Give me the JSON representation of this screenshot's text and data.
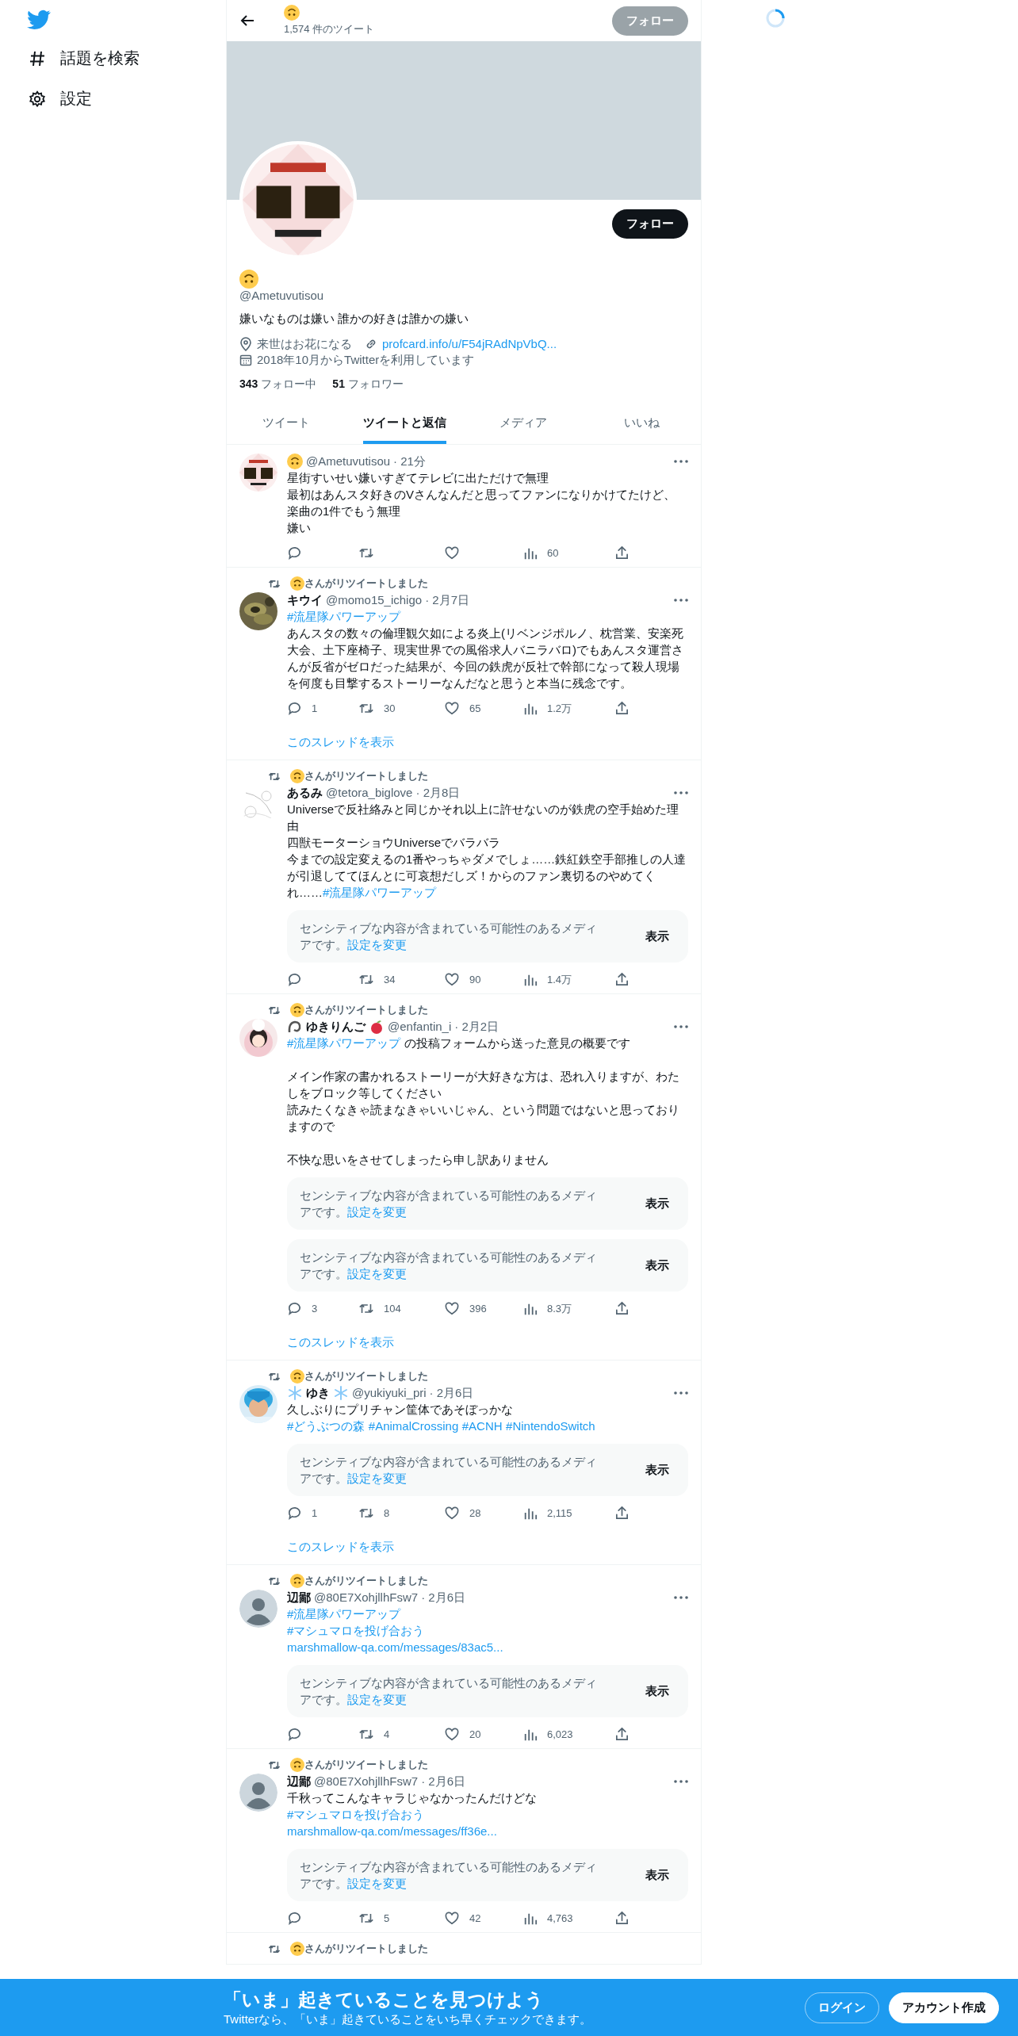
{
  "sidebar": {
    "items": [
      {
        "kind": "hashtag",
        "label": "話題を検索"
      },
      {
        "kind": "settings",
        "label": "設定"
      }
    ]
  },
  "header": {
    "name_icon": {
      "kind": "upside_down_face"
    },
    "tweet_count": "1,574 件のツイート",
    "follow_button": {
      "label": "フォロー",
      "disabled": true
    }
  },
  "profile": {
    "avatar": {
      "kind": "picture"
    },
    "follow_button": {
      "label": "フォロー",
      "disabled": false
    },
    "name_icon": {
      "kind": "upside_down_face"
    },
    "handle": "@Ametuvutisou",
    "bio": "嫌いなものは嫌い 誰かの好きは誰かの嫌い",
    "location": "来世はお花になる",
    "url": "profcard.info/u/F54jRAdNpVbQ...",
    "joined": "2018年10月からTwitterを利用しています",
    "following_count": "343",
    "following_label": "フォロー中",
    "followers_count": "51",
    "followers_label": "フォロワー"
  },
  "tabs": [
    {
      "label": "ツイート",
      "selected": false
    },
    {
      "label": "ツイートと返信",
      "selected": true
    },
    {
      "label": "メディア",
      "selected": false
    },
    {
      "label": "いいね",
      "selected": false
    }
  ],
  "tweets": [
    {
      "avatar": {
        "kind": "picture"
      },
      "name_icon": {
        "kind": "upside_down_face"
      },
      "handle": "@Ametuvutisou",
      "date": "· 21分",
      "body": [
        {
          "lines": [
            [
              {
                "kind": "text",
                "text": "星街すいせい嫌いすぎてテレビに出ただけで無理"
              }
            ],
            [
              {
                "kind": "text",
                "text": "最初はあんスタ好きのVさんなんだと思ってファンになりかけてたけど、"
              }
            ],
            [
              {
                "kind": "text",
                "text": "楽曲の1件でもう無理"
              }
            ],
            [
              {
                "kind": "text",
                "text": "嫌い"
              }
            ]
          ]
        }
      ],
      "stats": [
        {
          "kind": "reply"
        },
        {
          "kind": "retweet"
        },
        {
          "kind": "like"
        },
        {
          "kind": "views",
          "count": "60"
        },
        {
          "kind": "share"
        }
      ]
    },
    {
      "retweet": {
        "icon": {
          "kind": "upside_down_face"
        },
        "label": "さんがリツイートしました"
      },
      "avatar": {
        "kind": "picture"
      },
      "name": "キウイ",
      "handle": "@momo15_ichigo",
      "date": "· 2月7日",
      "body": [
        {
          "lines": [
            [
              {
                "kind": "link",
                "text": "#流星隊パワーアップ"
              }
            ],
            [
              {
                "kind": "text",
                "text": "あんスタの数々の倫理観欠如による炎上(リベンジポルノ、枕営業、安楽死大会、土下座椅子、現実世界での風俗求人バニラバロ)でもあんスタ運営さんが反省がゼロだった結果が、今回の鉄虎が反社で幹部になって殺人現場を何度も目撃するストーリーなんだなと思うと本当に残念です。"
              }
            ]
          ]
        }
      ],
      "stats": [
        {
          "kind": "reply",
          "count": "1"
        },
        {
          "kind": "retweet",
          "count": "30"
        },
        {
          "kind": "like",
          "count": "65"
        },
        {
          "kind": "views",
          "count": "1.2万"
        },
        {
          "kind": "share"
        }
      ],
      "thread_link": "このスレッドを表示"
    },
    {
      "retweet": {
        "icon": {
          "kind": "upside_down_face"
        },
        "label": "さんがリツイートしました"
      },
      "avatar": {
        "kind": "picture"
      },
      "name": "あるみ",
      "handle": "@tetora_biglove",
      "date": "· 2月8日",
      "body": [
        {
          "lines": [
            [
              {
                "kind": "text",
                "text": "Universeで反社絡みと同じかそれ以上に許せないのが鉄虎の空手始めた理由"
              }
            ],
            [
              {
                "kind": "text",
                "text": "四獣モーターショウUniverseでバラバラ"
              }
            ],
            [
              {
                "kind": "text",
                "text": "今までの設定変えるの1番やっちゃダメでしょ……鉄紅鉄空手部推しの人達が引退しててほんとに可哀想だしズ！からのファン裏切るのやめてくれ……"
              },
              {
                "kind": "link",
                "text": "#流星隊パワーアップ"
              }
            ]
          ]
        }
      ],
      "notices": [
        {
          "text": "センシティブな内容が含まれている可能性のあるメディアです。",
          "link": "設定を変更",
          "button": "表示"
        }
      ],
      "stats": [
        {
          "kind": "reply"
        },
        {
          "kind": "retweet",
          "count": "34"
        },
        {
          "kind": "like",
          "count": "90"
        },
        {
          "kind": "views",
          "count": "1.4万"
        },
        {
          "kind": "share"
        }
      ]
    },
    {
      "retweet": {
        "icon": {
          "kind": "upside_down_face"
        },
        "label": "さんがリツイートしました"
      },
      "avatar": {
        "kind": "picture"
      },
      "icon_before": {
        "kind": "knot"
      },
      "name": "ゆきりんご",
      "icon_after": {
        "kind": "apple"
      },
      "handle": "@enfantin_i",
      "date": "· 2月2日",
      "body": [
        {
          "lines": [
            [
              {
                "kind": "link",
                "text": "#流星隊パワーアップ"
              },
              {
                "kind": "text",
                "text": " の投稿フォームから送った意見の概要です"
              }
            ]
          ]
        },
        {
          "lines": [
            [
              {
                "kind": "text",
                "text": "メイン作家の書かれるストーリーが大好きな方は、恐れ入りますが、わたしをブロック等してください"
              }
            ],
            [
              {
                "kind": "text",
                "text": "読みたくなきゃ読まなきゃいいじゃん、という問題ではないと思っておりますので"
              }
            ]
          ]
        },
        {
          "lines": [
            [
              {
                "kind": "text",
                "text": "不快な思いをさせてしまったら申し訳ありません"
              }
            ]
          ]
        }
      ],
      "notices": [
        {
          "text": "センシティブな内容が含まれている可能性のあるメディアです。",
          "link": "設定を変更",
          "button": "表示"
        },
        {
          "text": "センシティブな内容が含まれている可能性のあるメディアです。",
          "link": "設定を変更",
          "button": "表示"
        }
      ],
      "stats": [
        {
          "kind": "reply",
          "count": "3"
        },
        {
          "kind": "retweet",
          "count": "104"
        },
        {
          "kind": "like",
          "count": "396"
        },
        {
          "kind": "views",
          "count": "8.3万"
        },
        {
          "kind": "share"
        }
      ],
      "thread_link": "このスレッドを表示"
    },
    {
      "retweet": {
        "icon": {
          "kind": "upside_down_face"
        },
        "label": "さんがリツイートしました"
      },
      "avatar": {
        "kind": "picture"
      },
      "icon_before": {
        "kind": "snowflake"
      },
      "name": "ゆき",
      "icon_after": {
        "kind": "snowflake"
      },
      "handle": "@yukiyuki_pri",
      "date": "· 2月6日",
      "body": [
        {
          "lines": [
            [
              {
                "kind": "text",
                "text": "久しぶりにプリチャン筐体であそぼっかな"
              }
            ],
            [
              {
                "kind": "link",
                "text": "#どうぶつの森"
              },
              {
                "kind": "link",
                "text": "#AnimalCrossing"
              },
              {
                "kind": "link",
                "text": "#ACNH"
              },
              {
                "kind": "link",
                "text": "#NintendoSwitch"
              }
            ]
          ]
        }
      ],
      "notices": [
        {
          "text": "センシティブな内容が含まれている可能性のあるメディアです。",
          "link": "設定を変更",
          "button": "表示"
        }
      ],
      "stats": [
        {
          "kind": "reply",
          "count": "1"
        },
        {
          "kind": "retweet",
          "count": "8"
        },
        {
          "kind": "like",
          "count": "28"
        },
        {
          "kind": "views",
          "count": "2,115"
        },
        {
          "kind": "share"
        }
      ],
      "thread_link": "このスレッドを表示"
    },
    {
      "retweet": {
        "icon": {
          "kind": "upside_down_face"
        },
        "label": "さんがリツイートしました"
      },
      "avatar": {
        "kind": "default"
      },
      "name": "辺鄙",
      "handle": "@80E7XohjllhFsw7",
      "date": "· 2月6日",
      "body": [
        {
          "lines": [
            [
              {
                "kind": "link",
                "text": "#流星隊パワーアップ"
              }
            ],
            [
              {
                "kind": "link",
                "text": "#マシュマロを投げ合おう"
              }
            ],
            [
              {
                "kind": "link",
                "text": "marshmallow-qa.com/messages/83ac5..."
              }
            ]
          ]
        }
      ],
      "notices": [
        {
          "text": "センシティブな内容が含まれている可能性のあるメディアです。",
          "link": "設定を変更",
          "button": "表示"
        }
      ],
      "stats": [
        {
          "kind": "reply"
        },
        {
          "kind": "retweet",
          "count": "4"
        },
        {
          "kind": "like",
          "count": "20"
        },
        {
          "kind": "views",
          "count": "6,023"
        },
        {
          "kind": "share"
        }
      ]
    },
    {
      "retweet": {
        "icon": {
          "kind": "upside_down_face"
        },
        "label": "さんがリツイートしました"
      },
      "avatar": {
        "kind": "default"
      },
      "name": "辺鄙",
      "handle": "@80E7XohjllhFsw7",
      "date": "· 2月6日",
      "body": [
        {
          "lines": [
            [
              {
                "kind": "text",
                "text": "千秋ってこんなキャラじゃなかったんだけどな"
              }
            ],
            [
              {
                "kind": "link",
                "text": "#マシュマロを投げ合おう"
              }
            ],
            [
              {
                "kind": "link",
                "text": "marshmallow-qa.com/messages/ff36e..."
              }
            ]
          ]
        }
      ],
      "notices": [
        {
          "text": "センシティブな内容が含まれている可能性のあるメディアです。",
          "link": "設定を変更",
          "button": "表示"
        }
      ],
      "stats": [
        {
          "kind": "reply"
        },
        {
          "kind": "retweet",
          "count": "5"
        },
        {
          "kind": "like",
          "count": "42"
        },
        {
          "kind": "views",
          "count": "4,763"
        },
        {
          "kind": "share"
        }
      ]
    },
    {
      "retweet": {
        "icon": {
          "kind": "upside_down_face"
        },
        "label": "さんがリツイートしました"
      }
    }
  ],
  "signup_banner": {
    "title": "「いま」起きていることを見つけよう",
    "subtitle": "Twitterなら、「いま」起きていることをいち早くチェックできます。",
    "buttons": [
      {
        "kind": "outline",
        "label": "ログイン"
      },
      {
        "kind": "filled",
        "label": "アカウント作成"
      }
    ]
  }
}
